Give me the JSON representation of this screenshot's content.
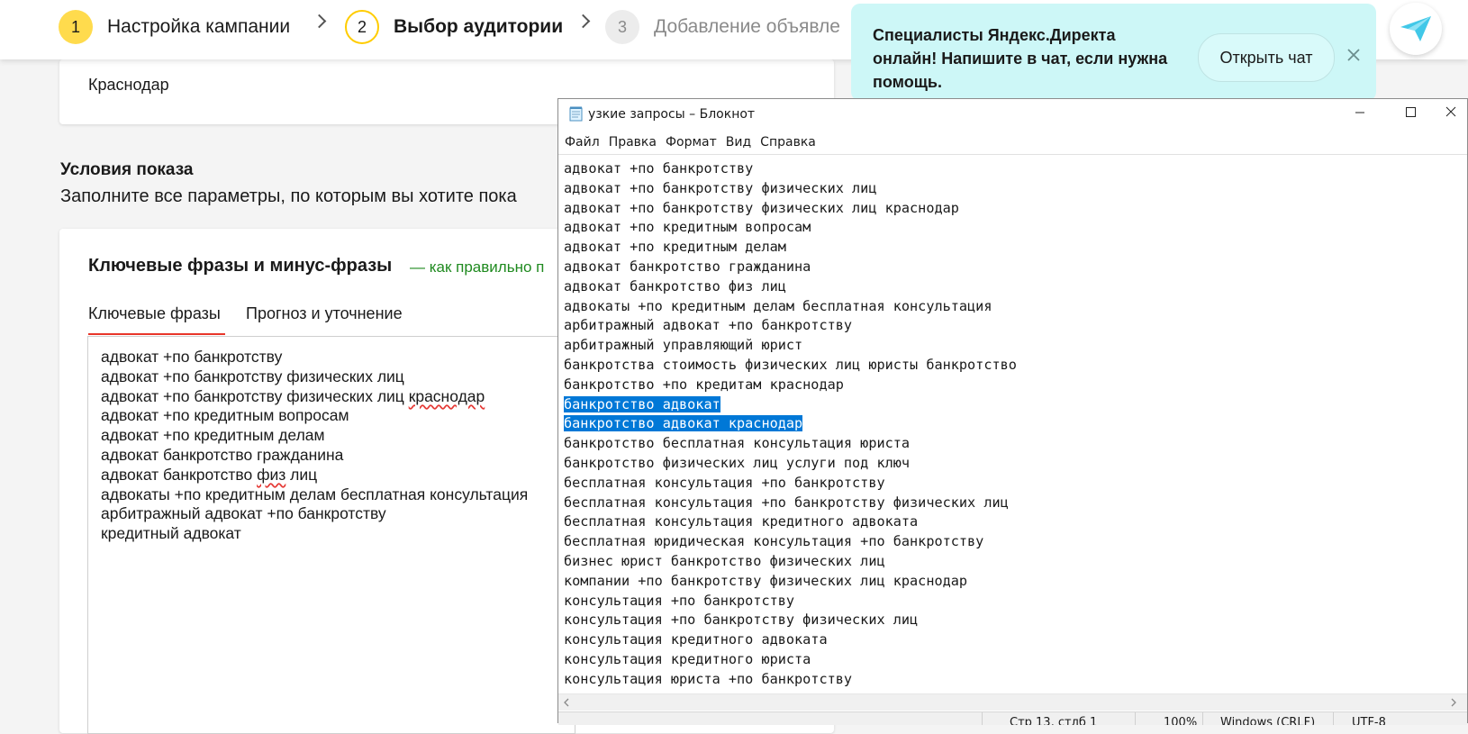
{
  "steps": [
    {
      "num": "1",
      "label": "Настройка кампании"
    },
    {
      "num": "2",
      "label": "Выбор аудитории"
    },
    {
      "num": "3",
      "label": "Добавление объявле"
    }
  ],
  "colors": {
    "accent_yellow": "#ffdb4d",
    "link_green": "#1f8a1f",
    "selection_blue": "#0078d7",
    "chat_bg": "#cdf7f7"
  },
  "page": {
    "city": "Краснодар",
    "section_title": "Условия показа",
    "section_desc": "Заполните все параметры, по которым вы хотите пока",
    "keywords_title": "Ключевые фразы и минус-фразы",
    "keywords_link": "— как правильно п",
    "tabs": [
      "Ключевые фразы",
      "Прогноз и уточнение"
    ],
    "keyword_lines": [
      {
        "text": "адвокат +по банкротству"
      },
      {
        "text": "адвокат +по банкротству физических лиц"
      },
      {
        "text": "адвокат +по банкротству физических лиц ",
        "spell": "краснодар"
      },
      {
        "text": "адвокат +по кредитным вопросам"
      },
      {
        "text": "адвокат +по кредитным делам"
      },
      {
        "text": "адвокат банкротство гражданина"
      },
      {
        "text": "адвокат банкротство ",
        "spell": "физ",
        "after": " лиц"
      },
      {
        "text": "адвокаты +по кредитным делам бесплатная консультация"
      },
      {
        "text": "арбитражный адвокат +по банкротству"
      },
      {
        "text": "кредитный адвокат"
      }
    ]
  },
  "chat": {
    "text": "Специалисты Яндекс.Директа онлайн! Напишите в чат, если нужна помощь.",
    "button": "Открыть чат"
  },
  "notepad": {
    "title": "узкие запросы – Блокнот",
    "menu": [
      "Файл",
      "Правка",
      "Формат",
      "Вид",
      "Справка"
    ],
    "lines": [
      "адвокат +по банкротству",
      "адвокат +по банкротству физических лиц",
      "адвокат +по банкротству физических лиц краснодар",
      "адвокат +по кредитным вопросам",
      "адвокат +по кредитным делам",
      "адвокат банкротство гражданина",
      "адвокат банкротство физ лиц",
      "адвокаты +по кредитным делам бесплатная консультация",
      "арбитражный адвокат +по банкротству",
      "арбитражный управляющий юрист",
      "банкротства стоимость физических лиц юристы банкротство",
      "банкротство +по кредитам краснодар",
      "банкротство адвокат",
      "банкротство адвокат краснодар",
      "банкротство бесплатная консультация юриста",
      "банкротство физических лиц услуги под ключ",
      "бесплатная консультация +по банкротству",
      "бесплатная консультация +по банкротству физических лиц",
      "бесплатная консультация кредитного адвоката",
      "бесплатная юридическая консультация +по банкротству",
      "бизнес юрист банкротство физических лиц",
      "компании +по банкротству физических лиц краснодар",
      "консультация +по банкротству",
      "консультация +по банкротству физических лиц",
      "консультация кредитного адвоката",
      "консультация кредитного юриста",
      "консультация юриста +по банкротству"
    ],
    "selected_lines": [
      12,
      13
    ],
    "status": {
      "position": "Стр 13, стлб 1",
      "zoom": "100%",
      "line_endings": "Windows (CRLF)",
      "encoding": "UTF-8"
    }
  }
}
